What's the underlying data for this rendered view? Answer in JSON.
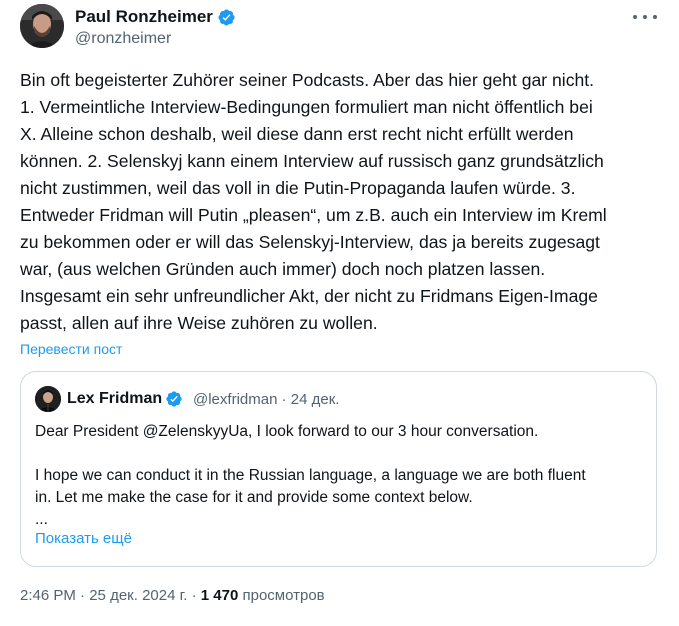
{
  "author": {
    "name": "Paul Ronzheimer",
    "handle": "@ronzheimer"
  },
  "tweet": {
    "lines": [
      "Bin oft begeisterter Zuhörer seiner Podcasts. Aber das hier geht gar nicht.",
      "1. Vermeintliche Interview-Bedingungen formuliert man nicht öffentlich bei",
      "X. Alleine schon deshalb, weil diese dann erst recht nicht erfüllt werden",
      "können. 2. Selenskyj kann einem Interview auf russisch ganz grundsätzlich",
      "nicht zustimmen, weil das voll in die Putin-Propaganda laufen würde. 3.",
      "Entweder Fridman will Putin „pleasen“, um z.B. auch ein Interview im Kreml",
      "zu bekommen oder er will das Selenskyj-Interview, das ja bereits zugesagt",
      "war, (aus welchen Gründen auch immer) doch noch platzen lassen.",
      "Insgesamt ein sehr unfreundlicher Akt, der nicht zu Fridmans Eigen-Image",
      "passt, allen auf ihre Weise zuhören zu wollen."
    ],
    "translate_label": "Перевести пост"
  },
  "quote": {
    "name": "Lex Fridman",
    "handle": "@lexfridman",
    "separator": "·",
    "date": "24 дек.",
    "line1": "Dear President @ZelenskyyUa, I look forward to our 3 hour conversation.",
    "line2": "I hope we can conduct it in the Russian language, a language we are both fluent",
    "line3": "in. Let me make the case for it and provide some context below.",
    "line4": "...",
    "show_more": "Показать ещё"
  },
  "footer": {
    "time": "2:46 PM",
    "separator": "·",
    "date": "25 дек. 2024 г.",
    "views_count": "1 470",
    "views_label": "просмотров"
  },
  "colors": {
    "accent": "#1d9bf0",
    "text": "#0f1419",
    "secondary": "#536471",
    "border": "#cfd9de"
  },
  "icons": {
    "verified": "verified-badge-icon",
    "more": "more-options-icon"
  }
}
